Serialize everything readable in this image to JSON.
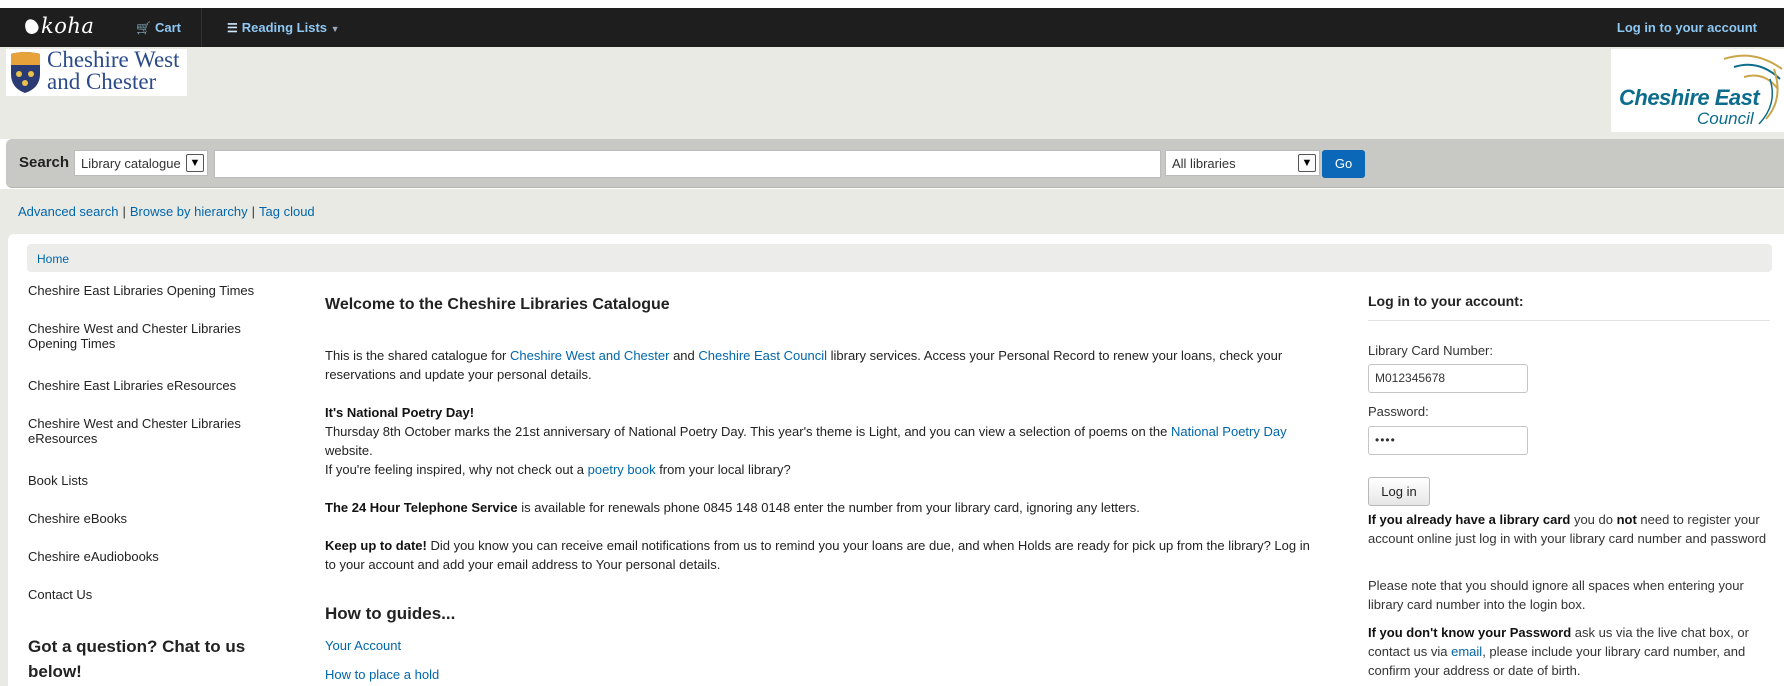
{
  "topbar": {
    "logo": "koha",
    "cart": "Cart",
    "reading_lists": "Reading Lists",
    "login": "Log in to your account"
  },
  "header": {
    "cwac_logo_line1": "Cheshire West",
    "cwac_logo_line2": "and Chester",
    "ce_logo_line1": "Cheshire East",
    "ce_logo_line2": "Council"
  },
  "search": {
    "label": "Search",
    "scope_selected": "Library catalogue",
    "query": "",
    "library_selected": "All libraries",
    "go_label": "Go"
  },
  "morelinks": {
    "advanced": "Advanced search",
    "browse": "Browse by hierarchy",
    "tagcloud": "Tag cloud",
    "separator": "|"
  },
  "breadcrumb": {
    "home": "Home"
  },
  "leftnav": {
    "items": [
      "Cheshire East Libraries Opening Times",
      "Cheshire West and Chester Libraries Opening Times",
      "Cheshire East Libraries eResources",
      "Cheshire West and Chester Libraries eResources",
      "Book Lists",
      "Cheshire eBooks",
      "Cheshire eAudiobooks",
      "Contact Us"
    ],
    "chat_heading": "Got a question? Chat to us below!"
  },
  "main": {
    "title": "Welcome to the Cheshire Libraries Catalogue",
    "intro_a": "This is the shared catalogue for ",
    "intro_link1": "Cheshire West and Chester",
    "intro_b": " and ",
    "intro_link2": "Cheshire East Council",
    "intro_c": " library services. Access your Personal Record to renew your loans, check your reservations and update your personal details.",
    "poetry_heading": "It's National Poetry Day!",
    "poetry_a": "Thursday 8th October marks the 21st anniversary of National Poetry Day. This year's theme is Light, and you can view a selection of poems on the ",
    "poetry_link": "National Poetry Day",
    "poetry_b": " website.",
    "poetry_c": "If you're feeling inspired, why not check out a ",
    "poetry_book_link": "poetry book",
    "poetry_d": " from your local library?",
    "phone_bold": "The 24 Hour Telephone Service",
    "phone_text": " is available for renewals phone 0845 148 0148 enter the number from your library card, ignoring any letters.",
    "keepup_bold": "Keep up to date!",
    "keepup_text": " Did you know you can receive email notifications from us to remind you your loans are due, and when Holds are ready for pick up from the library? Log in to your account and add your email address to Your personal details.",
    "howto_title": "How to guides...",
    "howto_links": [
      "Your Account",
      "How to place a hold"
    ]
  },
  "login": {
    "heading": "Log in to your account:",
    "card_label": "Library Card Number:",
    "card_value": "M012345678",
    "password_label": "Password:",
    "password_value": "••••",
    "button": "Log in",
    "p1_bold1": "If you already have a library card",
    "p1_a": " you do ",
    "p1_bold2": "not",
    "p1_b": " need to register your account online just log in with your library card number and password",
    "p2": "Please note that you should ignore all spaces when entering your library card number into the login box.",
    "p3_bold": "If you don't know your Password",
    "p3_a": " ask us via the live chat box, or contact us via ",
    "p3_link": "email",
    "p3_b": ", please include your library card number, and confirm your address or date of birth."
  },
  "colors": {
    "topbar": "#1e1e1e",
    "link": "#0066aa",
    "go_button": "#0b67b7",
    "header_bg": "#eaeae5",
    "searchbar_bg": "#c8c8c5"
  }
}
